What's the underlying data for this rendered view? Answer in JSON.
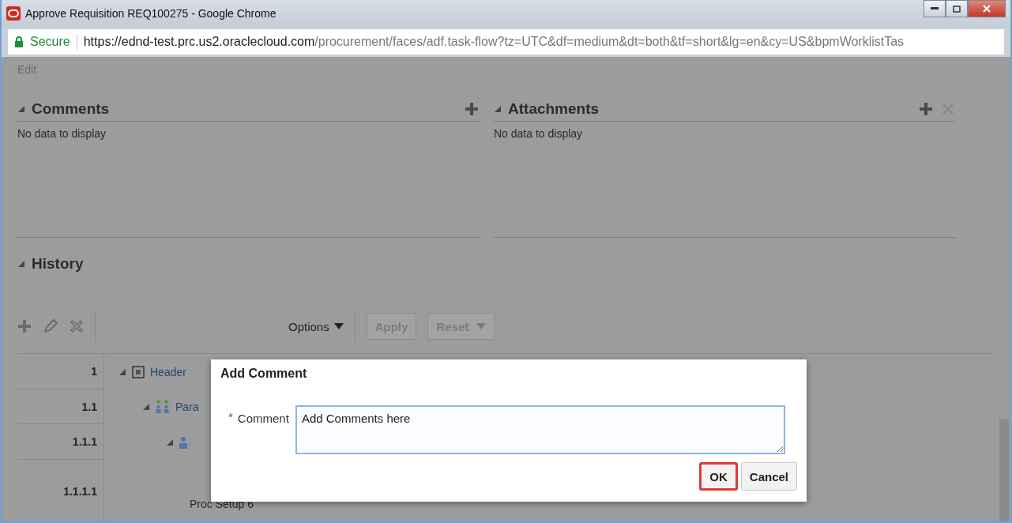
{
  "window": {
    "title": "Approve Requisition REQ100275 - Google Chrome"
  },
  "address_bar": {
    "security": "Secure",
    "url_host": "https://ednd-test.prc.us2.oraclecloud.com",
    "url_path": "/procurement/faces/adf.task-flow?tz=UTC&df=medium&dt=both&tf=short&lg=en&cy=US&bpmWorklistTas"
  },
  "menu": [
    "Edit"
  ],
  "panels": [
    {
      "title": "Comments",
      "expanded": true,
      "empty_text": "No data to display"
    },
    {
      "title": "Attachments",
      "expanded": true,
      "empty_text": "No data to display"
    }
  ],
  "history": {
    "title": "History",
    "expanded": true,
    "options": "Options",
    "apply": "Apply",
    "reset": "Reset",
    "rows": [
      {
        "number": "1",
        "label": "Header",
        "kind": "header",
        "expanded": true
      },
      {
        "number": "1.1",
        "label": "Para",
        "kind": "group",
        "expanded": true
      },
      {
        "number": "1.1.1",
        "label": "",
        "kind": "user",
        "expanded": true
      },
      {
        "number": "1.1.1.1",
        "label": "Proc Setup 6",
        "kind": "plain",
        "expanded": false
      }
    ]
  },
  "dialog": {
    "title": "Add Comment",
    "required_mark": "*",
    "field_label": "Comment",
    "value": "Add Comments here",
    "buttons": [
      {
        "label": "OK",
        "selected": true
      },
      {
        "label": "Cancel",
        "selected": false
      }
    ]
  }
}
